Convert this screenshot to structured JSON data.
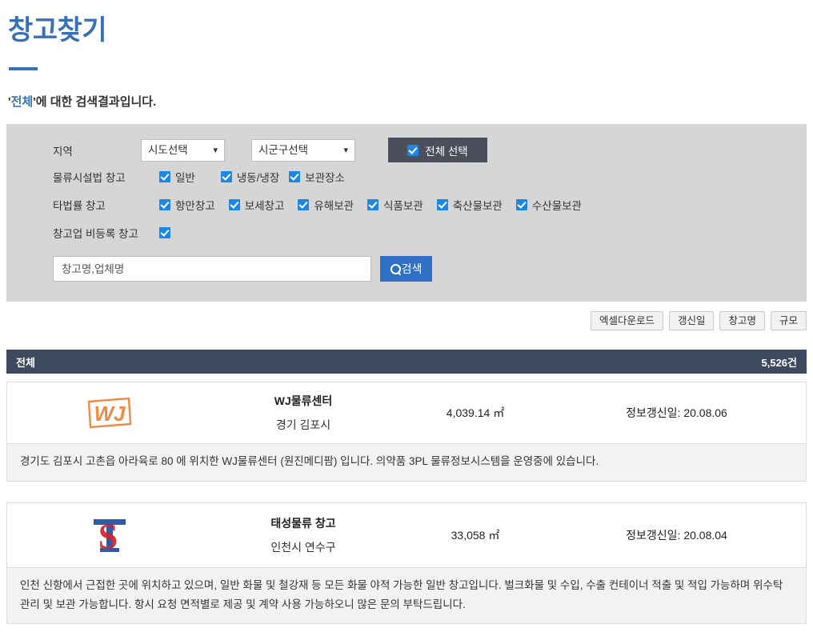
{
  "header": {
    "title": "창고찾기",
    "result_prefix": "'",
    "result_keyword": "전체",
    "result_suffix": "'에 대한 검색결과입니다."
  },
  "filters": {
    "region": {
      "label": "지역",
      "sido_selected": "시도선택",
      "sigungu_selected": "시군구선택",
      "select_all_label": "전체 선택"
    },
    "logistics_law": {
      "label": "물류시설법 창고",
      "items": [
        {
          "label": "일반",
          "checked": true
        },
        {
          "label": "냉동/냉장",
          "checked": true
        },
        {
          "label": "보관장소",
          "checked": true
        }
      ]
    },
    "other_law": {
      "label": "타법률 창고",
      "items": [
        {
          "label": "항만창고",
          "checked": true
        },
        {
          "label": "보세창고",
          "checked": true
        },
        {
          "label": "유해보관",
          "checked": true
        },
        {
          "label": "식품보관",
          "checked": true
        },
        {
          "label": "축산물보관",
          "checked": true
        },
        {
          "label": "수산물보관",
          "checked": true
        }
      ]
    },
    "unregistered": {
      "label": "창고업 비등록 창고",
      "checked": true
    },
    "search": {
      "placeholder": "창고명,업체명",
      "value": "",
      "button_label": "검색",
      "button_icon": "search-icon"
    }
  },
  "sortbar": {
    "buttons": [
      {
        "label": "엑셀다운로드",
        "name": "excel-download-button"
      },
      {
        "label": "갱신일",
        "name": "sort-updated-button"
      },
      {
        "label": "창고명",
        "name": "sort-name-button"
      },
      {
        "label": "규모",
        "name": "sort-size-button"
      }
    ]
  },
  "count_bar": {
    "label": "전체",
    "count": "5,526건"
  },
  "results": [
    {
      "logo": "wj-logo",
      "name": "WJ물류센터",
      "location": "경기 김포시",
      "size_value": "4,039.14",
      "size_unit": "㎡",
      "size_display": "4,039.14 ㎡",
      "updated_label": "정보갱신일: 20.08.06",
      "description": "경기도 김포시 고촌읍 아라육로 80 에 위치한 WJ물류센터 (원진메디팜) 입니다. 의약품 3PL 물류정보시스템을 운영중에 있습니다."
    },
    {
      "logo": "ts-logo",
      "name": "태성물류 창고",
      "location": "인천시 연수구",
      "size_value": "33,058",
      "size_unit": "㎡",
      "size_display": "33,058 ㎡",
      "updated_label": "정보갱신일: 20.08.04",
      "description": "인천 신항에서 근접한 곳에 위치하고 있으며, 일반 화물 및 철강재 등 모든 화물 야적 가능한 일반 창고입니다. 벌크화물 및 수입, 수출 컨테이너 적출 및 적입 가능하며 위수탁 관리 및 보관 가능합니다. 항시 요청 면적별로 제공 및 계약 사용 가능하오니 많은 문의 부탁드립니다."
    }
  ],
  "colors": {
    "brand_blue": "#3871b5",
    "search_blue": "#2f6fc4",
    "checkbox_blue": "#1d87e4",
    "panel_gray": "#d6d6d6",
    "count_bar_dark": "#3f4a5e",
    "select_all_dark": "#4b4e5b",
    "wj_orange": "#ef8b43",
    "ts_blue": "#2e5aa8",
    "ts_red": "#d6232c"
  }
}
